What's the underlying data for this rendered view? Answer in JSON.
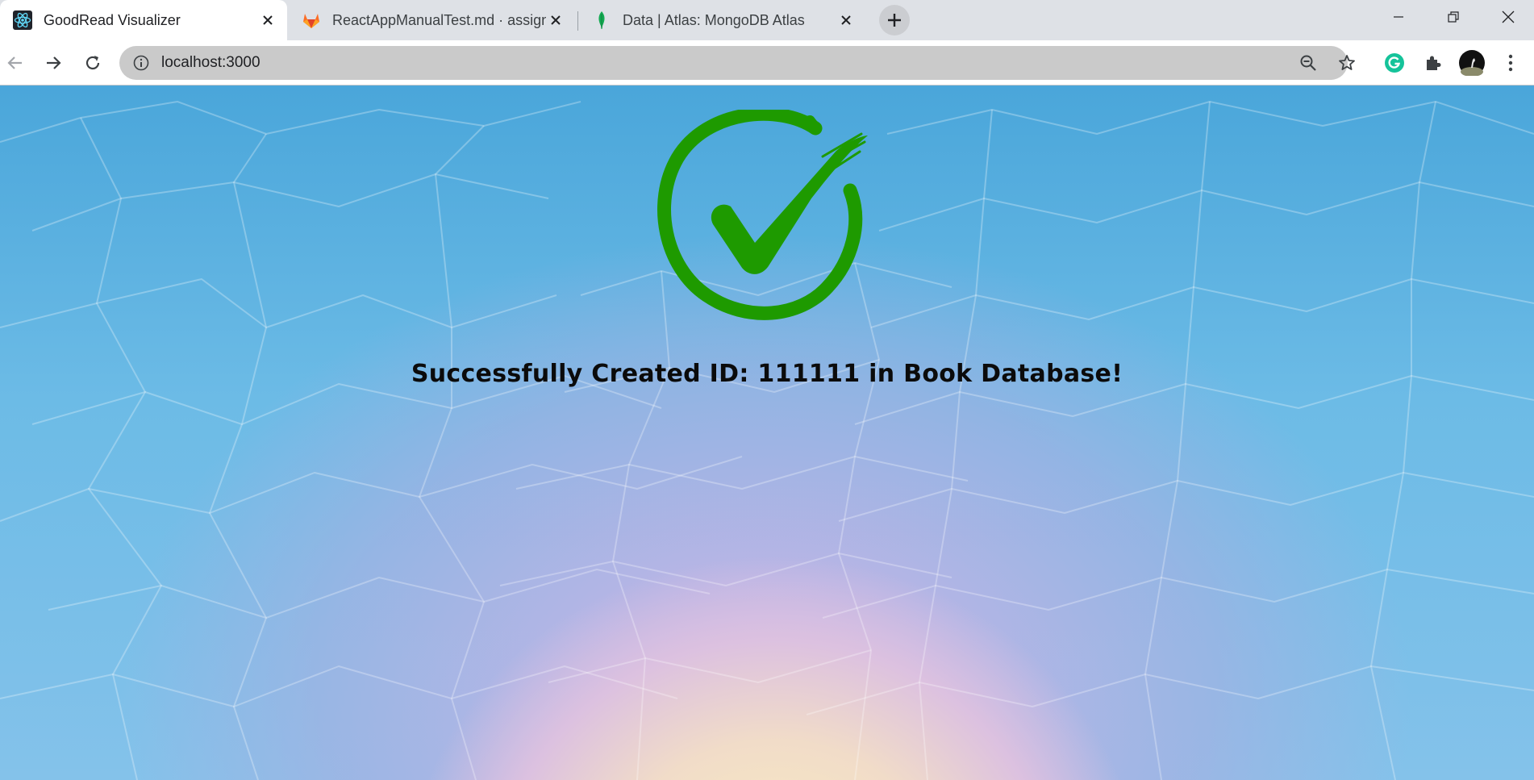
{
  "browser": {
    "tabs": [
      {
        "title": "GoodRead Visualizer",
        "favicon": "react-icon",
        "active": true
      },
      {
        "title": "ReactAppManualTest.md · assignments",
        "favicon": "gitlab-icon",
        "active": false
      },
      {
        "title": "Data | Atlas: MongoDB Atlas",
        "favicon": "mongodb-leaf-icon",
        "active": false
      }
    ],
    "url": "localhost:3000"
  },
  "page": {
    "message": "Successfully Created ID: 111111 in Book Database!",
    "icon": "success-checkmark-icon",
    "accent_color": "#1e9a00"
  }
}
